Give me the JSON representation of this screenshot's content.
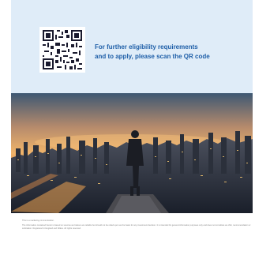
{
  "banner": {
    "cta_line1": "For further eligibility requirements",
    "cta_line2": "and to apply, please scan the QR code"
  },
  "hero": {
    "icon": "city-skyline-person-image"
  },
  "footer": {
    "heading": "This is a marketing communication.",
    "body": "The information contained herein is based on sources we believe are reliable but should not be relied upon as the basis for any investment decision. It is intended for general information purposes only and does not constitute an offer, recommendation or solicitation. Registered in England and Wales. All rights reserved."
  },
  "colors": {
    "banner_bg": "#dfecf8",
    "cta_text": "#1f5fa8"
  }
}
